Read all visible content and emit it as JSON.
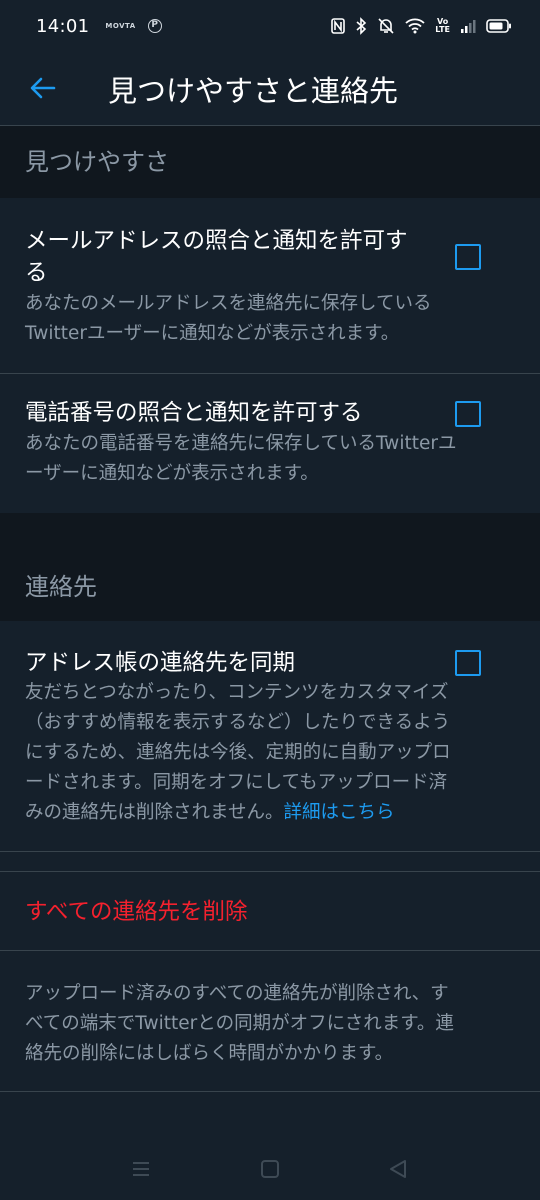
{
  "status_bar": {
    "time": "14:01",
    "mini_label_1": "MOVTA",
    "mini_label_2": "P",
    "volte_top": "Vo",
    "volte_bottom": "LTE"
  },
  "app_bar": {
    "title": "見つけやすさと連絡先",
    "back_icon": "arrow-left-icon"
  },
  "discoverability": {
    "header": "見つけやすさ",
    "email": {
      "title_line1": "メールアドレスの照合と通知を許可す",
      "title_line2": "る",
      "desc_line1": "あなたのメールアドレスを連絡先に保存している",
      "desc_line2": "Twitterユーザーに通知などが表示されます。",
      "checked": false
    },
    "phone": {
      "title": "電話番号の照合と通知を許可する",
      "desc_line1": "あなたの電話番号を連絡先に保存しているTwitterユ",
      "desc_line2": "ーザーに通知などが表示されます。",
      "checked": false
    }
  },
  "contacts": {
    "header": "連絡先",
    "sync": {
      "title": "アドレス帳の連絡先を同期",
      "desc_line1": "友だちとつながったり、コンテンツをカスタマイズ",
      "desc_line2": "（おすすめ情報を表示するなど）したりできるよう",
      "desc_line3": "にするため、連絡先は今後、定期的に自動アップロ",
      "desc_line4": "ードされます。同期をオフにしてもアップロード済",
      "desc_line5": "みの連絡先は削除されません。",
      "learn_more": "詳細はこちら",
      "checked": false
    },
    "delete_all": "すべての連絡先を削除",
    "delete_note_line1": "アップロード済みのすべての連絡先が削除され、す",
    "delete_note_line2": "べての端末でTwitterとの同期がオフにされます。連",
    "delete_note_line3": "絡先の削除にはしばらく時間がかかります。"
  },
  "colors": {
    "background": "#15202b",
    "section_bg": "#10171e",
    "accent": "#1d9bf0",
    "danger": "#f4212e",
    "secondary_text": "#8b98a5"
  },
  "nav_bar": {
    "icons": [
      "menu-icon",
      "home-square-icon",
      "back-triangle-icon"
    ]
  }
}
